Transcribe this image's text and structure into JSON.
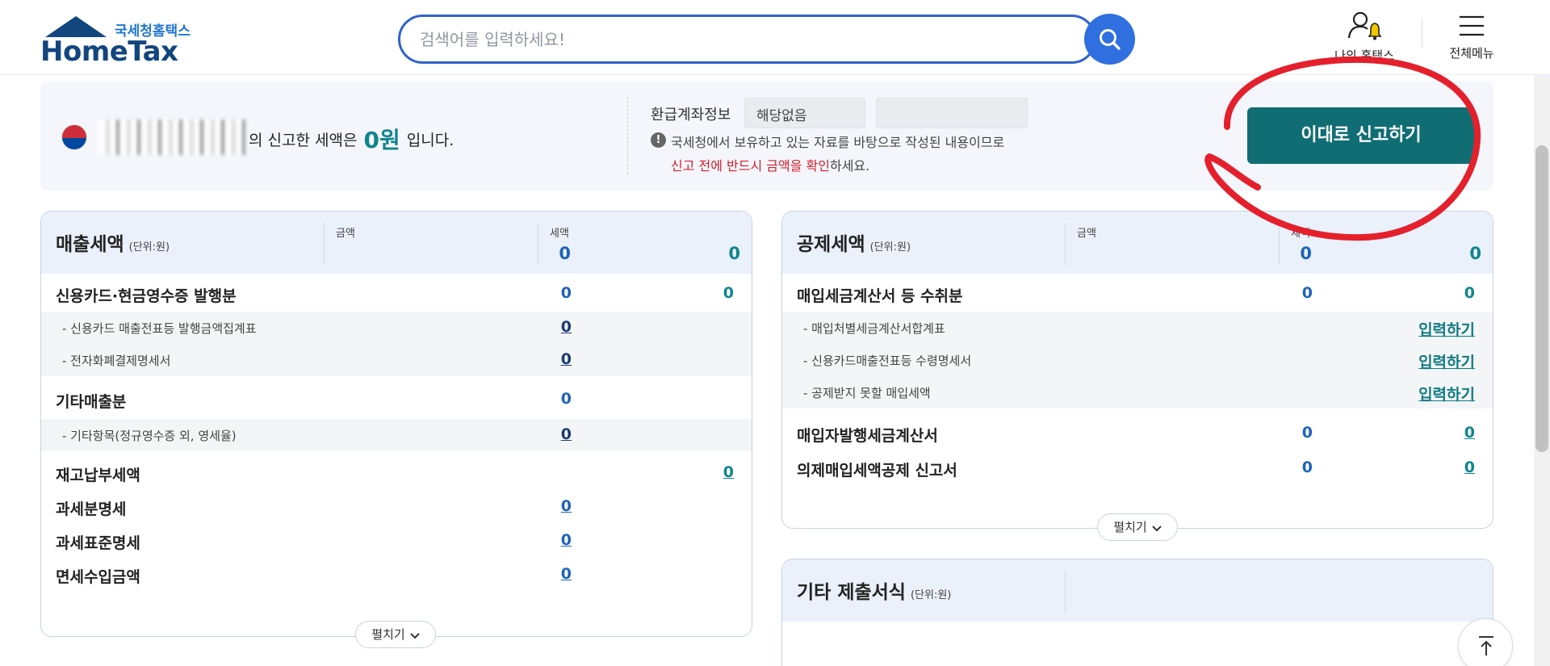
{
  "header": {
    "logo_sub": "국세청홈택스",
    "logo_main": "HomeTax",
    "search_placeholder": "검색어를 입력하세요!",
    "myhome_label": "나의 홈택스",
    "menu_label": "전체메뉴"
  },
  "notice": {
    "text_before": "의 신고한 세액은 ",
    "amount": "0원",
    "text_after": " 입니다.",
    "refund_label": "환급계좌정보",
    "refund_value": "해당없음",
    "info_line1": "국세청에서 보유하고 있는 자료를 바탕으로 작성된 내용이므로",
    "info_line2_red": "신고 전에 반드시 금액을 확인",
    "info_line2_rest": "하세요.",
    "file_button": "이대로 신고하기"
  },
  "sales_panel": {
    "title": "매출세액",
    "unit": "(단위:원)",
    "col_amount": "금액",
    "col_tax": "세액",
    "total_amount": "0",
    "total_tax": "0",
    "rows": [
      {
        "label": "신용카드·현금영수증 발행분",
        "amount": "0",
        "tax": "0"
      },
      {
        "label": "- 신용카드 매출전표등 발행금액집계표",
        "amount": "0"
      },
      {
        "label": "- 전자화폐결제명세서",
        "amount": "0"
      },
      {
        "label": "기타매출분",
        "amount": "0"
      },
      {
        "label": "- 기타항목(정규영수증 외, 영세율)",
        "amount": "0"
      },
      {
        "label": "재고납부세액",
        "tax": "0"
      },
      {
        "label": "과세분명세",
        "amount": "0"
      },
      {
        "label": "과세표준명세",
        "amount": "0"
      },
      {
        "label": "면세수입금액",
        "amount": "0"
      }
    ],
    "expand_label": "펼치기"
  },
  "deduction_panel": {
    "title": "공제세액",
    "unit": "(단위:원)",
    "col_amount": "금액",
    "col_tax": "세액",
    "total_amount": "0",
    "total_tax": "0",
    "rows": [
      {
        "label": "매입세금계산서 등 수취분",
        "amount": "0",
        "tax": "0"
      },
      {
        "label": "- 매입처별세금계산서합계표",
        "link": "입력하기"
      },
      {
        "label": "- 신용카드매출전표등 수령명세서",
        "link": "입력하기"
      },
      {
        "label": "- 공제받지 못할 매입세액",
        "link": "입력하기"
      },
      {
        "label": "매입자발행세금계산서",
        "amount": "0",
        "tax": "0"
      },
      {
        "label": "의제매입세액공제 신고서",
        "amount": "0",
        "tax": "0"
      }
    ],
    "expand_label": "펼치기"
  },
  "other_panel": {
    "title": "기타 제출서식",
    "unit": "(단위:원)"
  },
  "colors": {
    "brand_navy": "#12467f",
    "search_blue": "#2f63c9",
    "teal": "#10858d",
    "button_teal": "#106d74",
    "amount_blue": "#1f63b8",
    "annotation_red": "#e4202c"
  },
  "icons": [
    "search-icon",
    "person-bell-icon",
    "hamburger-menu-icon",
    "info-icon",
    "chevron-down-icon",
    "arrow-up-icon",
    "korea-emblem-icon"
  ]
}
